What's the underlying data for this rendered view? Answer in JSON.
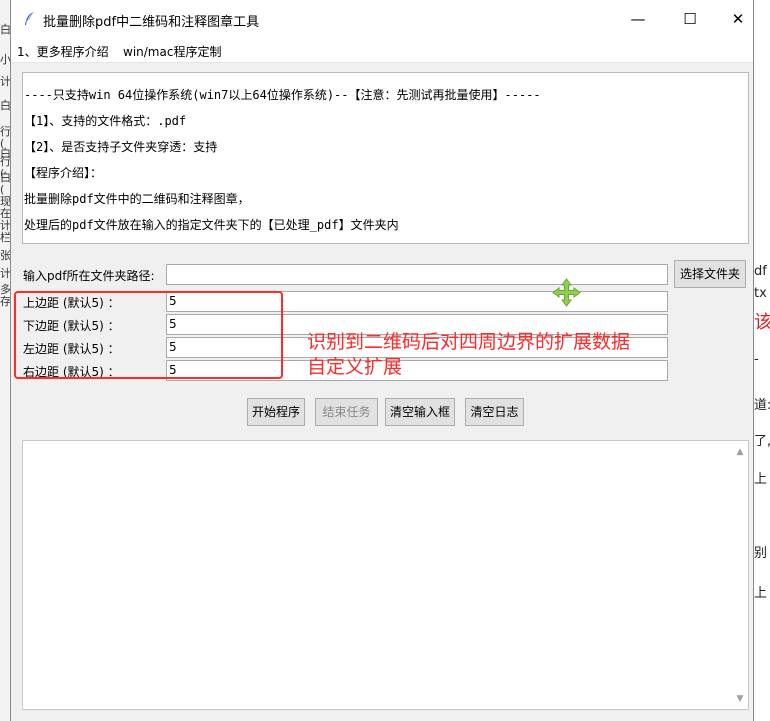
{
  "background_window_left": {
    "fragments": [
      "白",
      "小",
      "计",
      "白",
      "行 (",
      "白",
      "行 (",
      "白 (",
      "现在",
      "计栏",
      "张",
      "计",
      "多存"
    ]
  },
  "background_window_right": {
    "fragments": [
      "df",
      "tx",
      "该",
      "-",
      "道:",
      "了,",
      "上",
      "别",
      "上"
    ]
  },
  "window": {
    "title": "批量删除pdf中二维码和注释图章工具",
    "controls": {
      "minimize": "—",
      "maximize": "☐",
      "close": "✕"
    },
    "menu": [
      "1、更多程序介绍",
      "win/mac程序定制"
    ]
  },
  "info": {
    "lines": [
      "----只支持win 64位操作系统(win7以上64位操作系统)--【注意：先测试再批量使用】-----",
      "【1】、支持的文件格式：.pdf",
      "【2】、是否支持子文件夹穿透：支持",
      "【程序介绍】：",
      "批量删除pdf文件中的二维码和注释图章，",
      "处理后的pdf文件放在输入的指定文件夹下的【已处理_pdf】文件夹内"
    ]
  },
  "form": {
    "folder_label": "输入pdf所在文件夹路径:",
    "folder_value": "",
    "choose_button": "选择文件夹",
    "margins": [
      {
        "label": "上边距 (默认5) ：",
        "value": "5"
      },
      {
        "label": "下边距 (默认5) ：",
        "value": "5"
      },
      {
        "label": "左边距 (默认5) ：",
        "value": "5"
      },
      {
        "label": "右边距 (默认5) ：",
        "value": "5"
      }
    ]
  },
  "annotation": {
    "line1": "识别到二维码后对四周边界的扩展数据",
    "line2": "自定义扩展",
    "color": "#ff2b2b"
  },
  "actions": {
    "start": "开始程序",
    "stop": "结束任务",
    "clear_input": "清空输入框",
    "clear_log": "清空日志"
  },
  "log": {
    "content": ""
  }
}
